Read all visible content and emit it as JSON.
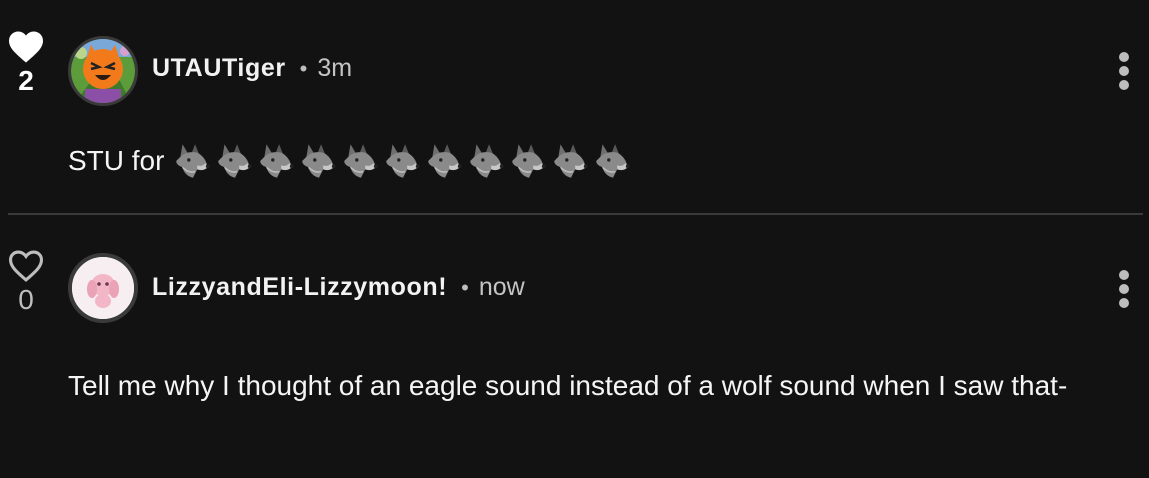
{
  "comments": [
    {
      "likes": "2",
      "liked": true,
      "username": "UTAUTiger",
      "separator": "•",
      "time": "3m",
      "text": "STU for",
      "emoji": [
        "wolf-emoji",
        "wolf-emoji",
        "wolf-emoji",
        "wolf-emoji",
        "wolf-emoji",
        "wolf-emoji",
        "wolf-emoji",
        "wolf-emoji",
        "wolf-emoji",
        "wolf-emoji",
        "wolf-emoji"
      ]
    },
    {
      "likes": "0",
      "liked": false,
      "username": "LizzyandEli-Lizzymoon!",
      "separator": "•",
      "time": "now",
      "text": "Tell me why I thought of an eagle sound instead of a wolf sound when I saw that-"
    }
  ],
  "colors": {
    "background": "#121212",
    "divider": "#3a3a3a",
    "muted": "#bdbdbd"
  }
}
